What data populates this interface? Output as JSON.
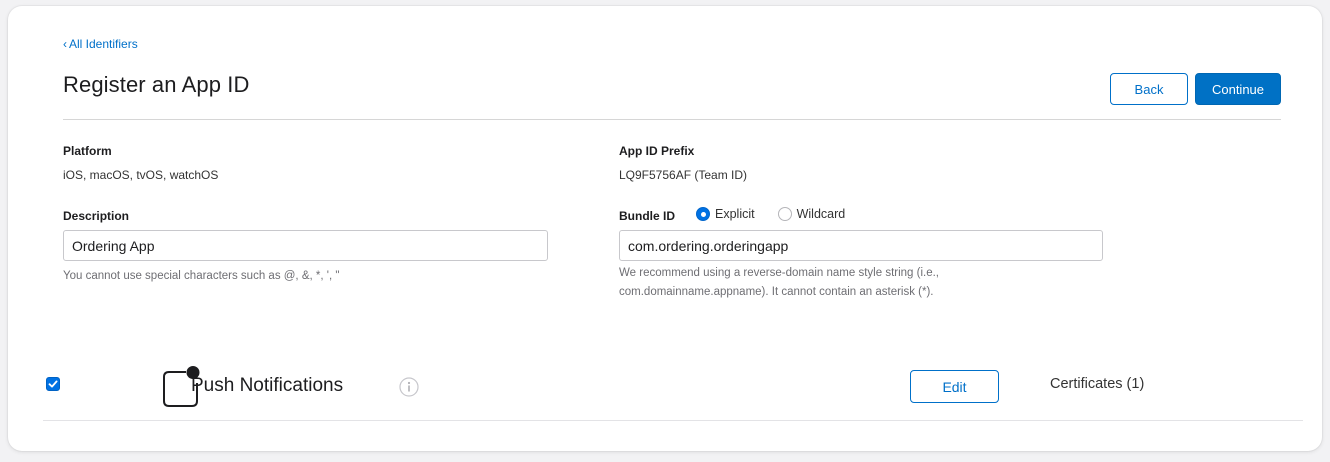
{
  "breadcrumb": {
    "chevron": "‹",
    "label": "All Identifiers"
  },
  "page": {
    "title": "Register an App ID"
  },
  "actions": {
    "back_label": "Back",
    "continue_label": "Continue"
  },
  "platform": {
    "label": "Platform",
    "value": "iOS, macOS, tvOS, watchOS"
  },
  "app_id_prefix": {
    "label": "App ID Prefix",
    "value": "LQ9F5756AF (Team ID)"
  },
  "description": {
    "label": "Description",
    "value": "Ordering App",
    "help": "You cannot use special characters such as @, &, *, ', \""
  },
  "bundle_id": {
    "label": "Bundle ID",
    "options": [
      {
        "label": "Explicit",
        "selected": true
      },
      {
        "label": "Wildcard",
        "selected": false
      }
    ],
    "value": "com.ordering.orderingapp",
    "help_line1": "We recommend using a reverse-domain name style string (i.e.,",
    "help_line2": "com.domainname.appname). It cannot contain an asterisk (*)."
  },
  "capabilities": [
    {
      "enabled": true,
      "icon": "push-notifications-icon",
      "name": "Push Notifications",
      "info_icon": "info-icon",
      "edit_label": "Edit",
      "certificates_label": "Certificates (1)"
    }
  ],
  "colors": {
    "accent": "#0071e3",
    "link": "#0070c9",
    "text": "#1d1d1f",
    "muted": "#6e6e73",
    "divider": "#d6d6d6"
  }
}
